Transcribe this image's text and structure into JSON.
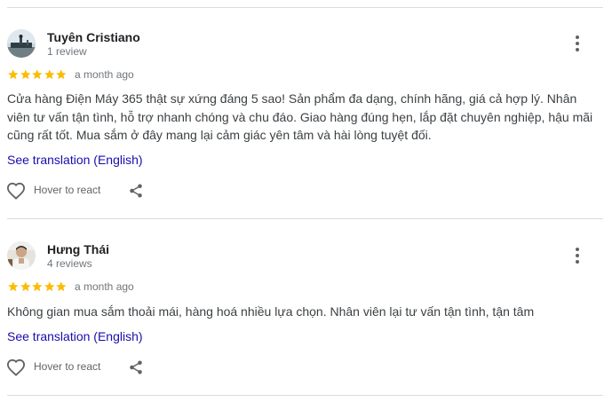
{
  "colors": {
    "star": "#fbbc04",
    "link": "#1a0dab",
    "divider": "#dadce0",
    "muted": "#70757a"
  },
  "reviews": [
    {
      "author": "Tuyên Cristiano",
      "review_count": "1 review",
      "rating": 5,
      "date": "a month ago",
      "text": "Cửa hàng Điện Máy 365 thật sự xứng đáng 5 sao! Sản phẩm đa dạng, chính hãng, giá cả hợp lý. Nhân viên tư vấn tận tình, hỗ trợ nhanh chóng và chu đáo. Giao hàng đúng hẹn, lắp đặt chuyên nghiệp, hậu mãi cũng rất tốt. Mua sắm ở đây mang lại cảm giác yên tâm và hài lòng tuyệt đối.",
      "translate_label": "See translation (English)",
      "react_label": "Hover to react",
      "avatar_icon": "avatar-photo-icon",
      "more_icon": "more-vert-icon",
      "react_icon": "heart-outline-icon",
      "share_icon": "share-icon"
    },
    {
      "author": "Hưng Thái",
      "review_count": "4 reviews",
      "rating": 5,
      "date": "a month ago",
      "text": "Không gian mua sắm thoải mái, hàng hoá nhiều lựa chọn. Nhân viên lại tư vấn tận tình, tận tâm",
      "translate_label": "See translation (English)",
      "react_label": "Hover to react",
      "avatar_icon": "avatar-photo-icon",
      "more_icon": "more-vert-icon",
      "react_icon": "heart-outline-icon",
      "share_icon": "share-icon"
    }
  ]
}
